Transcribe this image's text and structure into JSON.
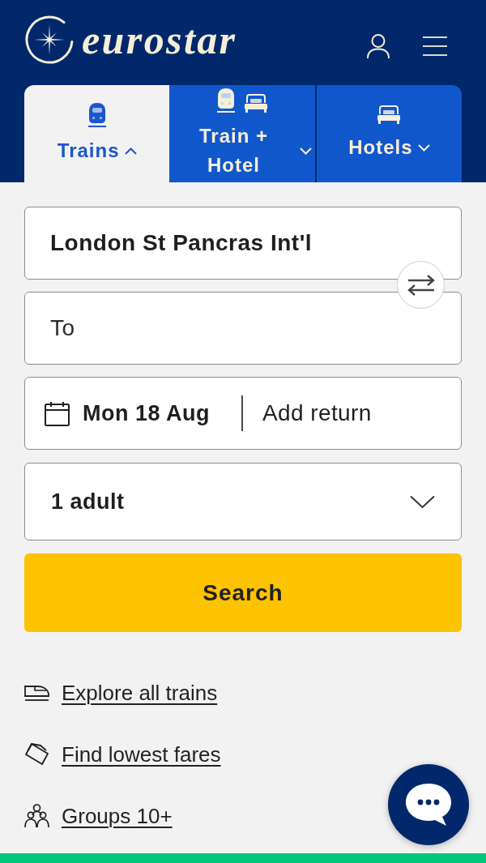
{
  "header": {
    "logo": "eurostar"
  },
  "tabs": [
    {
      "label": "Trains",
      "kind": "trains",
      "selected": true,
      "expanded": true
    },
    {
      "label": "Train + Hotel",
      "kind": "train_hotel",
      "selected": false,
      "expanded": false
    },
    {
      "label": "Hotels",
      "kind": "hotels",
      "selected": false,
      "expanded": false
    }
  ],
  "journey_form": {
    "origin": {
      "value": "London St Pancras Int'l"
    },
    "destination": {
      "placeholder": "To"
    },
    "dates": {
      "outbound": "Mon 18 Aug",
      "add_return": "Add return"
    },
    "passengers": {
      "value": "1 adult"
    },
    "search_button": "Search"
  },
  "links": [
    {
      "label": "Explore all trains",
      "kind": "trains"
    },
    {
      "label": "Find lowest fares",
      "kind": "fares"
    },
    {
      "label": "Groups 10+",
      "kind": "groups"
    }
  ]
}
